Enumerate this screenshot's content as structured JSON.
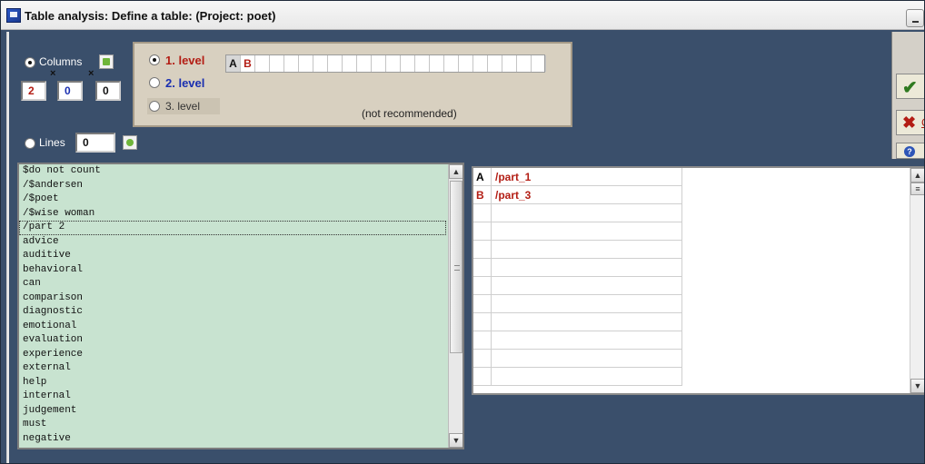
{
  "window": {
    "title": "Table analysis: Define a table: (Project: poet)"
  },
  "dimensions": {
    "columns_label": "Columns",
    "lines_label": "Lines",
    "col_values": [
      "2",
      "0",
      "0"
    ],
    "lines_value": "0",
    "multiply_symbol": "×"
  },
  "levels": {
    "items": [
      {
        "label": "1. level",
        "color": "#b31d14"
      },
      {
        "label": "2. level",
        "color": "#1a2fb0"
      },
      {
        "label": "3. level",
        "color": "#333333"
      }
    ],
    "not_recommended": "(not recommended)",
    "grid_cells": [
      "A",
      "B",
      "",
      "",
      "",
      "",
      "",
      "",
      "",
      "",
      "",
      "",
      "",
      "",
      "",
      "",
      "",
      "",
      "",
      "",
      "",
      ""
    ]
  },
  "code_list": {
    "items": [
      "$do not count",
      "/$andersen",
      "/$poet",
      "/$wise woman",
      "/part 2",
      "advice",
      "auditive",
      "behavioral",
      "can",
      "comparison",
      "diagnostic",
      "emotional",
      "evaluation",
      "experience",
      "external",
      "help",
      "internal",
      "judgement",
      "must",
      "negative"
    ],
    "selected_index": 4
  },
  "table": {
    "rows": [
      {
        "id": "A",
        "value": "/part_1"
      },
      {
        "id": "B",
        "value": "/part_3"
      }
    ]
  },
  "actions": {
    "ok_icon": "check-icon",
    "cancel_icon": "x-icon",
    "cancel_letter": "C",
    "help_icon": "help-icon",
    "help_glyph": "?"
  }
}
